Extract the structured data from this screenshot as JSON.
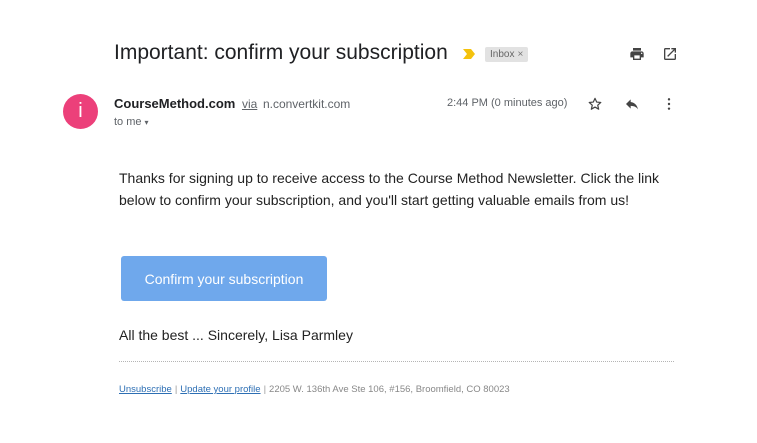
{
  "email": {
    "subject": "Important: confirm your subscription",
    "label": "Inbox",
    "label_close": "×",
    "sender_initial": "i",
    "sender_name": "CourseMethod.com",
    "via_text": "via",
    "via_domain": "n.convertkit.com",
    "recipient": "to me",
    "recipient_caret": "▾",
    "time": "2:44 PM (0 minutes ago)",
    "icons": {
      "important": "important-marker-icon",
      "print": "print-icon",
      "open_new_window": "open-in-new-window-icon",
      "star": "star-icon",
      "reply": "reply-icon",
      "more": "more-vertical-icon"
    },
    "colors": {
      "avatar": "#ec407a",
      "important_marker": "#f4c20d",
      "button": "#6fa8ec",
      "link": "#2d6fb4"
    }
  },
  "message": {
    "body": "Thanks for signing up to receive access to the Course Method Newsletter. Click the link below to confirm your subscription, and you'll start getting valuable emails from us!",
    "button_label": "Confirm your subscription",
    "signoff": "All the best ... Sincerely, Lisa Parmley",
    "footer": {
      "unsubscribe": "Unsubscribe",
      "separator": "|",
      "update_profile": "Update your profile",
      "address": "2205 W. 136th Ave Ste 106, #156, Broomfield, CO 80023"
    }
  }
}
